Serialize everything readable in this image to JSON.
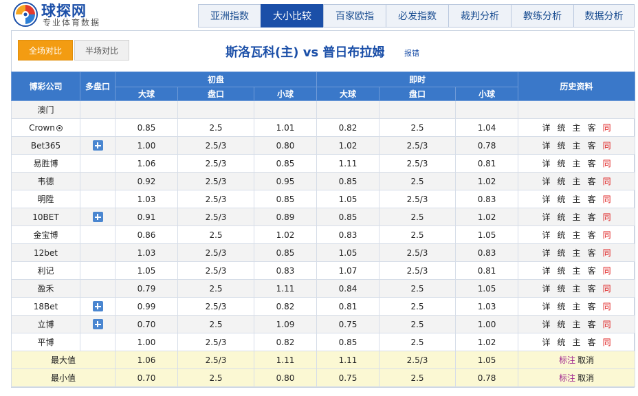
{
  "logo": {
    "title": "球探网",
    "subtitle": "专业体育数据"
  },
  "topnav": [
    "亚洲指数",
    "大小比较",
    "百家欧指",
    "必发指数",
    "裁判分析",
    "教练分析",
    "数据分析"
  ],
  "toggles": {
    "full": "全场对比",
    "half": "半场对比"
  },
  "match": {
    "title": "斯洛瓦科(主) vs 普日布拉姆",
    "report": "报错"
  },
  "table": {
    "headers": {
      "company": "博彩公司",
      "multi": "多盘口",
      "initial": "初盘",
      "live": "即时",
      "history": "历史资料",
      "over": "大球",
      "line": "盘口",
      "under": "小球"
    },
    "section_label": "澳门",
    "hist_links": [
      "详",
      "统",
      "主",
      "客",
      "同"
    ],
    "rows": [
      {
        "name": "Crown",
        "ball": true,
        "plus": false,
        "init": [
          "0.85",
          "2.5",
          "1.01"
        ],
        "live": [
          "0.82",
          "2.5",
          "1.04"
        ]
      },
      {
        "name": "Bet365",
        "ball": false,
        "plus": true,
        "init": [
          "1.00",
          "2.5/3",
          "0.80"
        ],
        "live": [
          "1.02",
          "2.5/3",
          "0.78"
        ]
      },
      {
        "name": "易胜博",
        "ball": false,
        "plus": false,
        "init": [
          "1.06",
          "2.5/3",
          "0.85"
        ],
        "live": [
          "1.11",
          "2.5/3",
          "0.81"
        ]
      },
      {
        "name": "韦德",
        "ball": false,
        "plus": false,
        "init": [
          "0.92",
          "2.5/3",
          "0.95"
        ],
        "live": [
          "0.85",
          "2.5",
          "1.02"
        ]
      },
      {
        "name": "明陞",
        "ball": false,
        "plus": false,
        "init": [
          "1.03",
          "2.5/3",
          "0.85"
        ],
        "live": [
          "1.05",
          "2.5/3",
          "0.83"
        ]
      },
      {
        "name": "10BET",
        "ball": false,
        "plus": true,
        "init": [
          "0.91",
          "2.5/3",
          "0.89"
        ],
        "live": [
          "0.85",
          "2.5",
          "1.02"
        ]
      },
      {
        "name": "金宝博",
        "ball": false,
        "plus": false,
        "init": [
          "0.86",
          "2.5",
          "1.02"
        ],
        "live": [
          "0.83",
          "2.5",
          "1.05"
        ]
      },
      {
        "name": "12bet",
        "ball": false,
        "plus": false,
        "init": [
          "1.03",
          "2.5/3",
          "0.85"
        ],
        "live": [
          "1.05",
          "2.5/3",
          "0.83"
        ]
      },
      {
        "name": "利记",
        "ball": false,
        "plus": false,
        "init": [
          "1.05",
          "2.5/3",
          "0.83"
        ],
        "live": [
          "1.07",
          "2.5/3",
          "0.81"
        ]
      },
      {
        "name": "盈禾",
        "ball": false,
        "plus": false,
        "init": [
          "0.79",
          "2.5",
          "1.11"
        ],
        "live": [
          "0.84",
          "2.5",
          "1.05"
        ]
      },
      {
        "name": "18Bet",
        "ball": false,
        "plus": true,
        "init": [
          "0.99",
          "2.5/3",
          "0.82"
        ],
        "live": [
          "0.81",
          "2.5",
          "1.03"
        ]
      },
      {
        "name": "立博",
        "ball": false,
        "plus": true,
        "init": [
          "0.70",
          "2.5",
          "1.09"
        ],
        "live": [
          "0.75",
          "2.5",
          "1.00"
        ]
      },
      {
        "name": "平博",
        "ball": false,
        "plus": false,
        "init": [
          "1.00",
          "2.5/3",
          "0.82"
        ],
        "live": [
          "0.85",
          "2.5",
          "1.02"
        ]
      }
    ],
    "stats": [
      {
        "label": "最大值",
        "init": [
          "1.06",
          "2.5/3",
          "1.11"
        ],
        "live": [
          "1.11",
          "2.5/3",
          "1.05"
        ]
      },
      {
        "label": "最小值",
        "init": [
          "0.70",
          "2.5",
          "0.80"
        ],
        "live": [
          "0.75",
          "2.5",
          "0.78"
        ]
      }
    ],
    "stat_links": {
      "mark": "标注",
      "cancel": "取消"
    }
  }
}
